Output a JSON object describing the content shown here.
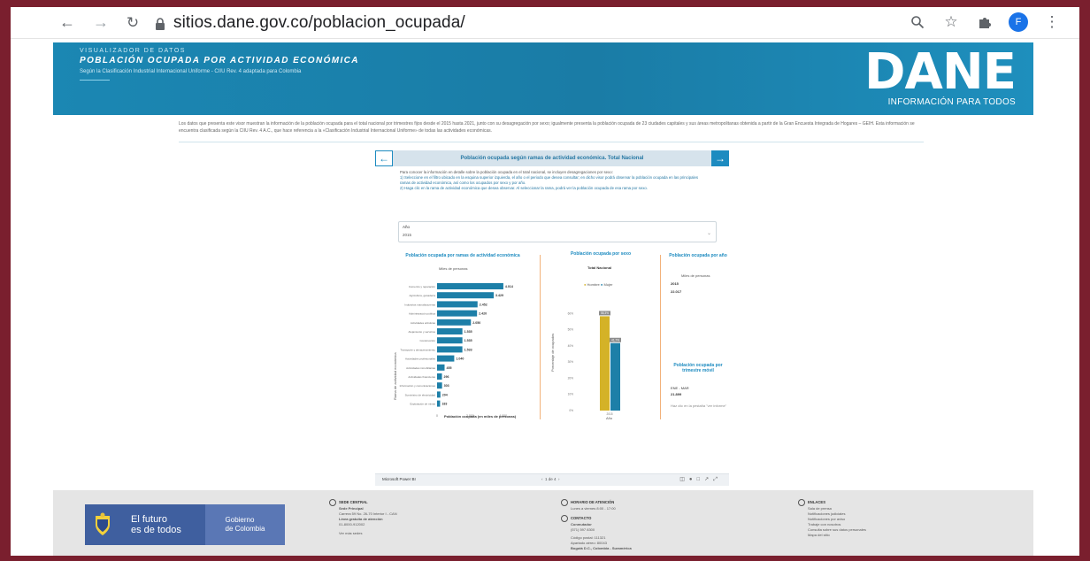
{
  "browser": {
    "url": "sitios.dane.gov.co/poblacion_ocupada/",
    "profile_initial": "F"
  },
  "banner": {
    "kicker": "VISUALIZADOR DE DATOS",
    "title": "POBLACIÓN OCUPADA POR ACTIVIDAD ECONÓMICA",
    "subtitle": "Según la Clasificación Industrial Internacional Uniforme - CIIU Rev. 4 adaptada para Colombia",
    "logo": "DANE",
    "logo_tagline": "INFORMACIÓN PARA TODOS"
  },
  "intro_text": "Los datos que presenta este visor muestran la información de la población ocupada para el total nacional por trimestres fijos desde el 2015 hasta 2021, junto con su desagregación por sexo; igualmente presenta la población ocupada de 23 ciudades capitales y sus áreas metropolitanas obtenida a partir de la Gran Encuesta Integrada de Hogares – GEIH. Esta información se encuentra clasificada según la CIIU Rev. 4 A.C., que hace referencia a la «Clasificación Industrial Internacional Uniforme» de todas las actividades económicas.",
  "report": {
    "header": "Población ocupada según ramas de actividad económica. Total Nacional",
    "instructions": [
      "Para conocer la información en detalle sobre la población ocupada en el total nacional, se incluyen desagregaciones por sexo:",
      "1) Seleccione en el filtro ubicado en la esquina superior izquierda, el año o el periodo que desea consultar; en dicho visor podrá observar la población ocupada en las principales ramas de actividad económica, así como los ocupados por sexo y por año.",
      "2) Haga clic en la rama de actividad económica que desea observar. Al seleccionar la rama, podrá ver la población ocupada de esa rama por sexo."
    ],
    "filter_label": "Año",
    "filter_value": "2015",
    "branch_title": "Población ocupada por ramas de actividad económica",
    "branch_subtitle": "Miles de personas",
    "branch_xlabel": "Población ocupada (en miles de personas)",
    "branch_ylabel": "Rama de actividad económica",
    "branch_ticks": [
      "0",
      "2.000",
      "4.000"
    ],
    "sex_title": "Población ocupada por sexo",
    "sex_subtitle": "Total Nacional",
    "sex_legend": [
      "Hombre",
      "Mujer"
    ],
    "sex_ylabel": "Porcentaje de ocupados",
    "sex_xlabel": "Año",
    "year_title": "Población ocupada por año",
    "year_subtitle": "Miles de personas",
    "year_value_label": "2015",
    "year_value": "22.017",
    "quarter_title": "Población ocupada por trimestre móvil",
    "quarter_label": "ENE - MAR",
    "quarter_value": "21.899",
    "quarter_note": "Haz clic en la pestaña \"ver informe\""
  },
  "chart_data": [
    {
      "type": "bar",
      "orientation": "horizontal",
      "title": "Población ocupada por ramas de actividad económica",
      "categories": [
        "Comercio y reparación",
        "Agricultura, ganadería",
        "Industrias manufactureras",
        "Administración pública",
        "Actividades artísticas",
        "Alojamiento y servicios",
        "Construcción",
        "Transporte y almacenamiento",
        "Actividades profesionales",
        "Actividades inmobiliarias",
        "Actividades financieras",
        "Información y comunicaciones",
        "Suministro de electricidad",
        "Explotación de minas"
      ],
      "values": [
        4014,
        3429,
        2452,
        2420,
        2050,
        1535,
        1535,
        1533,
        1040,
        455,
        296,
        303,
        204,
        183
      ],
      "value_labels": [
        "4.014",
        "3.429",
        "2.452",
        "2.420",
        "2.050",
        "1.535",
        "1.535",
        "1.533",
        "1.040",
        "455",
        "296",
        "303",
        "204",
        "183"
      ],
      "xlim": [
        0,
        4500
      ]
    },
    {
      "type": "bar",
      "title": "Población ocupada por sexo",
      "categories": [
        "2015"
      ],
      "series": [
        {
          "name": "Hombre",
          "values": [
            58.3
          ],
          "label": "58,3%"
        },
        {
          "name": "Mujer",
          "values": [
            41.7
          ],
          "label": "41,7%"
        }
      ],
      "ylim": [
        0,
        70
      ],
      "yticks": [
        "0%",
        "10%",
        "20%",
        "30%",
        "40%",
        "50%",
        "60%"
      ]
    }
  ],
  "pbibar": {
    "brand": "Microsoft Power BI",
    "page": "1 de 4"
  },
  "footer": {
    "gov_line1": "El futuro",
    "gov_line2": "es de todos",
    "gov_name1": "Gobierno",
    "gov_name2": "de Colombia",
    "col1_title": "SEDE CENTRAL",
    "col1_lines": [
      "Sede Principal",
      "Carrera 59 No. 26-70 Interior I - CAN",
      "Línea gratuita de atención",
      "01-8000-912002",
      "Ver más sedes"
    ],
    "col2_title": "HORARIO DE ATENCIÓN",
    "col2_lines": [
      "Lunes a viernes 8:00 - 17:00",
      "CONTACTO",
      "Conmutador",
      "(571) 597 8300",
      "Código postal: 111321",
      "Apartado aéreo: 80043",
      "Bogotá D.C., Colombia - Suramérica"
    ],
    "col3_title": "ENLACES",
    "col3_lines": [
      "Sala de prensa",
      "Notificaciones judiciales",
      "Notificaciones por aviso",
      "Trabaje con nosotros",
      "Consulta sobre sus datos personales",
      "Mapa del sitio"
    ]
  },
  "colors": {
    "frame": "#7a1f2e",
    "banner": "#1b87b3",
    "bar_blue": "#1d7fa8",
    "bar_gold": "#d4b227",
    "accent": "#1d8bc0"
  }
}
